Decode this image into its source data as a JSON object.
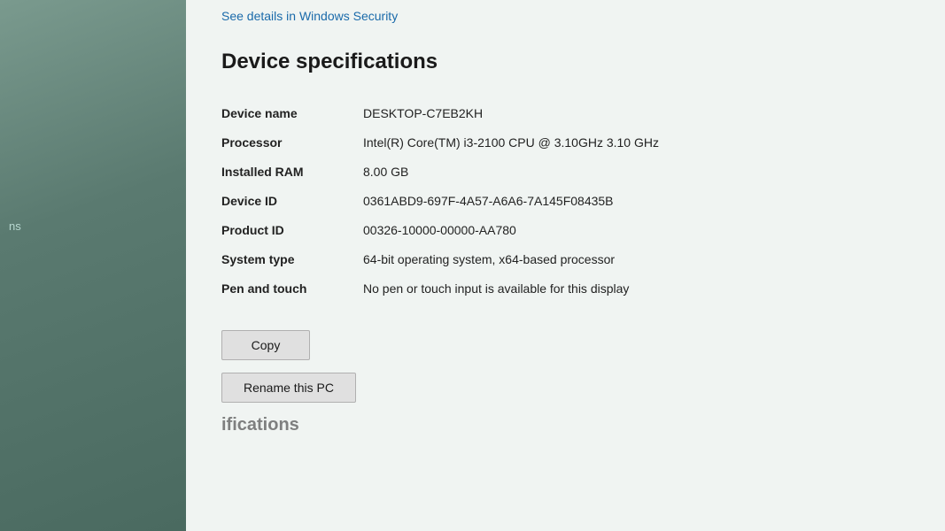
{
  "sidebar": {
    "side_label": "ns"
  },
  "main": {
    "link_text": "See details in Windows Security",
    "section_title": "Device specifications",
    "specs": [
      {
        "label": "Device name",
        "value": "DESKTOP-C7EB2KH"
      },
      {
        "label": "Processor",
        "value": "Intel(R) Core(TM) i3-2100 CPU @ 3.10GHz   3.10 GHz"
      },
      {
        "label": "Installed RAM",
        "value": "8.00 GB"
      },
      {
        "label": "Device ID",
        "value": "0361ABD9-697F-4A57-A6A6-7A145F08435B"
      },
      {
        "label": "Product ID",
        "value": "00326-10000-00000-AA780"
      },
      {
        "label": "System type",
        "value": "64-bit operating system, x64-based processor"
      },
      {
        "label": "Pen and touch",
        "value": "No pen or touch input is available for this display"
      }
    ],
    "copy_button": "Copy",
    "rename_button": "Rename this PC",
    "partial_footer": "ifications"
  }
}
